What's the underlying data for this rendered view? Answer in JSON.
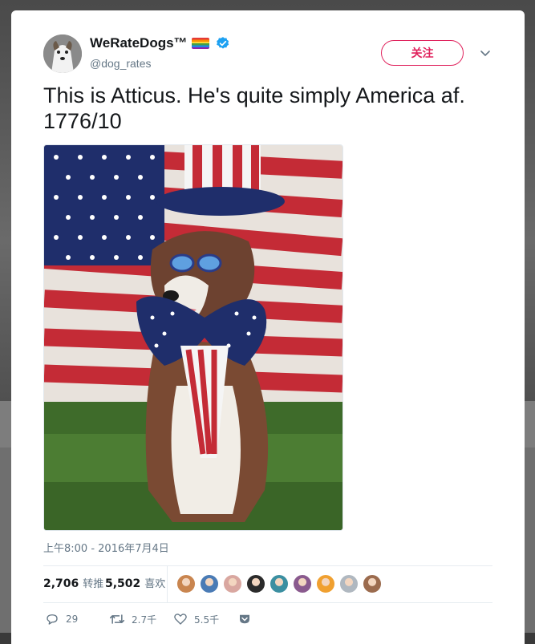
{
  "tweet": {
    "display_name": "WeRateDogs™",
    "handle": "@dog_rates",
    "follow_label": "关注",
    "text_line1": "This is Atticus. He's quite simply America af.",
    "text_line2": "1776/10",
    "timestamp": "上午8:00 - 2016年7月4日",
    "retweets": {
      "count": "2,706",
      "label": "转推"
    },
    "likes": {
      "count": "5,502",
      "label": "喜欢"
    },
    "actions": {
      "reply_count": "29",
      "retweet_count": "2.7千",
      "like_count": "5.5千"
    }
  },
  "icons": {
    "verified": "verified-badge-icon",
    "caret": "chevron-down-icon",
    "reply": "reply-icon",
    "retweet": "retweet-icon",
    "like": "heart-icon",
    "dm": "direct-message-icon"
  },
  "colors": {
    "follow_accent": "#e0245e",
    "verified_blue": "#1da1f2",
    "muted_text": "#657786",
    "primary_text": "#14171a"
  },
  "liker_colors": [
    "#c9854f",
    "#4a7bb5",
    "#d9a7a0",
    "#2b2b2b",
    "#3b8fa1",
    "#8a5a8e",
    "#f0a030",
    "#b0b8c0",
    "#9b6b4e"
  ]
}
